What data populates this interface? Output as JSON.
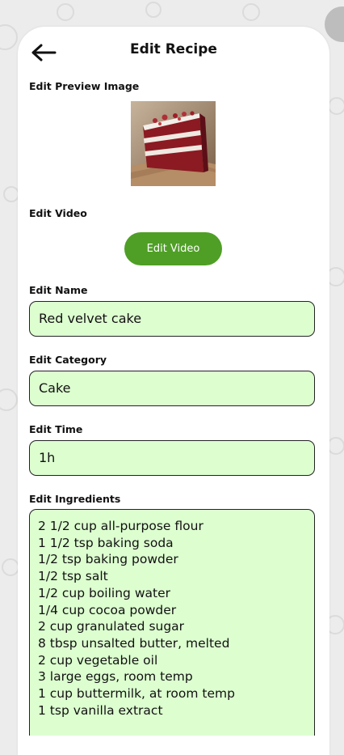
{
  "header": {
    "title": "Edit Recipe"
  },
  "sections": {
    "preview_image_label": "Edit Preview Image",
    "video_label": "Edit Video",
    "video_button": "Edit Video",
    "name_label": "Edit Name",
    "category_label": "Edit Category",
    "time_label": "Edit Time",
    "ingredients_label": "Edit Ingredients"
  },
  "fields": {
    "name": "Red velvet cake",
    "category": "Cake",
    "time": "1h"
  },
  "ingredients": [
    " 2 1/2 cup all-purpose flour",
    "1 1/2 tsp baking soda",
    "1/2 tsp baking powder",
    "1/2 tsp salt",
    "1/2 cup boiling water",
    "1/4 cup cocoa powder",
    "2 cup granulated sugar",
    "8 tbsp unsalted butter, melted",
    "2 cup vegetable oil",
    "3 large eggs, room temp",
    "1 cup buttermilk, at room temp",
    "1 tsp vanilla extract"
  ],
  "colors": {
    "accent": "#4f9f26",
    "field_bg": "#ddffd0"
  },
  "icons": {
    "back": "arrow-left-icon"
  }
}
